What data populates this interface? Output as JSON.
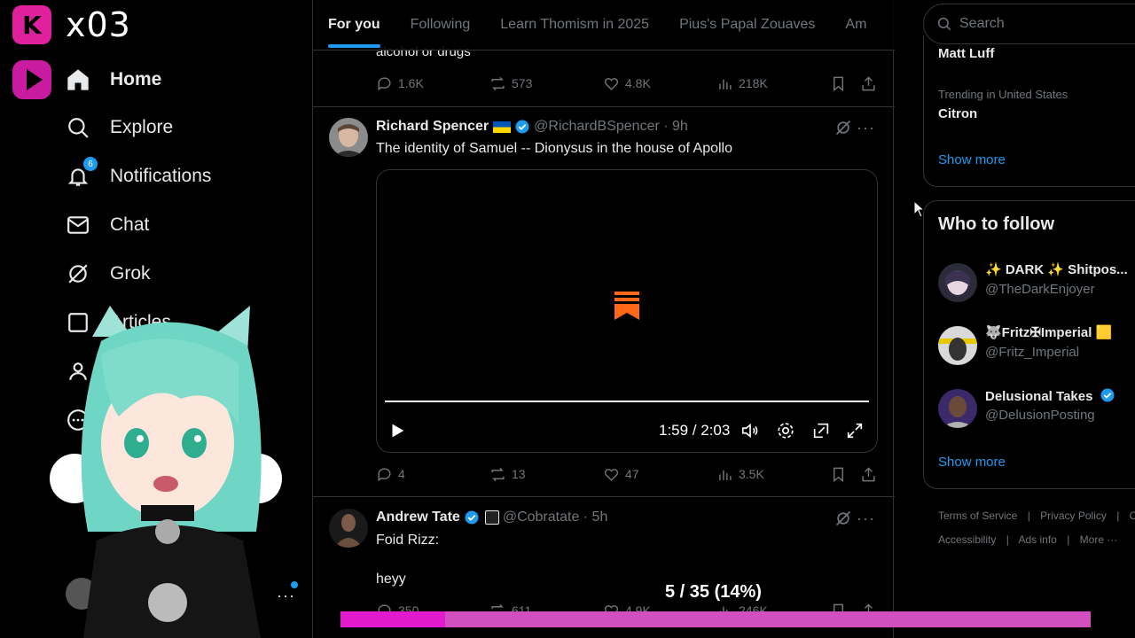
{
  "overlay": {
    "k_logo": "K",
    "score_text": "x03",
    "progress_label": "5 / 35 (14%)",
    "progress_fraction": 0.14
  },
  "nav": {
    "items": [
      {
        "label": "Home",
        "icon": "home-icon"
      },
      {
        "label": "Explore",
        "icon": "search-icon"
      },
      {
        "label": "Notifications",
        "icon": "bell-icon",
        "badge": "6"
      },
      {
        "label": "Chat",
        "icon": "mail-icon"
      },
      {
        "label": "Grok",
        "icon": "grok-icon"
      },
      {
        "label": "Articles",
        "icon": "article-icon"
      }
    ]
  },
  "tabs": [
    "For you",
    "Following",
    "Learn Thomism in 2025",
    "Pius's Papal Zouaves",
    "Am"
  ],
  "feed": {
    "prev_tweet": {
      "text": "alcohol or drugs",
      "replies": "1.6K",
      "reposts": "573",
      "likes": "4.8K",
      "views": "218K"
    },
    "tweet1": {
      "name": "Richard Spencer",
      "handle": "@RichardBSpencer · 9h",
      "text": "The identity of Samuel -- Dionysus in the house of Apollo",
      "video_time": "1:59 / 2:03",
      "video_progress": 0.97,
      "replies": "4",
      "reposts": "13",
      "likes": "47",
      "views": "3.5K"
    },
    "tweet2": {
      "name": "Andrew Tate",
      "handle": "@Cobratate · 5h",
      "text_line1": "Foid Rizz:",
      "text_line2": "heyy",
      "replies": "350",
      "reposts": "611",
      "likes": "4.9K",
      "views": "246K"
    }
  },
  "right": {
    "search_placeholder": "Search",
    "trend_top": "Matt Luff",
    "trend_meta": "Trending in United States",
    "trend_name": "Citron",
    "show_more": "Show more",
    "who_to_follow_title": "Who to follow",
    "follows": [
      {
        "name": "✨ DARK ✨ Shitpos...",
        "handle": "@TheDarkEnjoyer"
      },
      {
        "name": "🐺Fritz✠Imperial 🟨",
        "handle": "@Fritz_Imperial"
      },
      {
        "name": "Delusional Takes",
        "handle": "@DelusionPosting"
      }
    ],
    "footer_line1": [
      "Terms of Service",
      "|",
      "Privacy Policy",
      "|",
      "C"
    ],
    "footer_line2": [
      "Accessibility",
      "|",
      "Ads info",
      "|",
      "More ···"
    ]
  },
  "colors": {
    "accent": "#1d9bf0",
    "overlay_pink": "#e21acd",
    "substack_orange": "#ff6719"
  }
}
